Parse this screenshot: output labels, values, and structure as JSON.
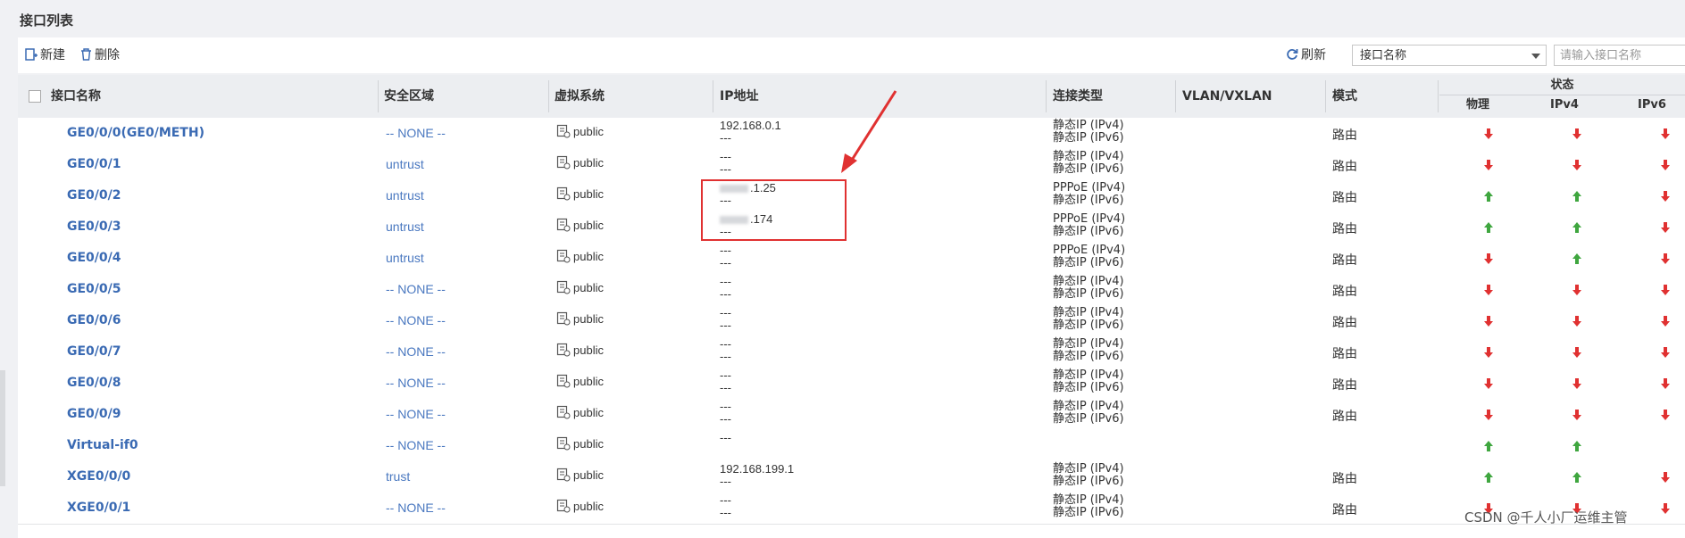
{
  "panel": {
    "title": "接口列表"
  },
  "toolbar": {
    "new_label": "新建",
    "delete_label": "删除",
    "refresh_label": "刷新",
    "filter_select_value": "接口名称",
    "search_placeholder": "请输入接口名称"
  },
  "columns": {
    "name": "接口名称",
    "zone": "安全区域",
    "vsys": "虚拟系统",
    "ip": "IP地址",
    "conn_type": "连接类型",
    "vlan": "VLAN/VXLAN",
    "mode": "模式",
    "status": "状态",
    "status_physical": "物理",
    "status_ipv4": "IPv4",
    "status_ipv6": "IPv6"
  },
  "colors": {
    "up": "#3fa63f",
    "down": "#e03131",
    "link": "#3a6ab3",
    "annotation": "#e03131"
  },
  "rows": [
    {
      "name": "GE0/0/0(GE0/METH)",
      "zone": "-- NONE --",
      "vsys": "public",
      "ip1": "192.168.0.1",
      "ip2": "---",
      "conn1": "静态IP (IPv4)",
      "conn2": "静态IP (IPv6)",
      "mode": "路由",
      "phy": "down",
      "v4": "down",
      "v6": "down"
    },
    {
      "name": "GE0/0/1",
      "zone": "untrust",
      "vsys": "public",
      "ip1": "---",
      "ip2": "---",
      "conn1": "静态IP (IPv4)",
      "conn2": "静态IP (IPv6)",
      "mode": "路由",
      "phy": "down",
      "v4": "down",
      "v6": "down"
    },
    {
      "name": "GE0/0/2",
      "zone": "untrust",
      "vsys": "public",
      "ip1": ".1.25",
      "ip2": "---",
      "conn1": "PPPoE (IPv4)",
      "conn2": "静态IP (IPv6)",
      "mode": "路由",
      "phy": "up",
      "v4": "up",
      "v6": "down"
    },
    {
      "name": "GE0/0/3",
      "zone": "untrust",
      "vsys": "public",
      "ip1": ".174",
      "ip2": "---",
      "conn1": "PPPoE (IPv4)",
      "conn2": "静态IP (IPv6)",
      "mode": "路由",
      "phy": "up",
      "v4": "up",
      "v6": "down"
    },
    {
      "name": "GE0/0/4",
      "zone": "untrust",
      "vsys": "public",
      "ip1": "---",
      "ip2": "---",
      "conn1": "PPPoE (IPv4)",
      "conn2": "静态IP (IPv6)",
      "mode": "路由",
      "phy": "down",
      "v4": "up",
      "v6": "down"
    },
    {
      "name": "GE0/0/5",
      "zone": "-- NONE --",
      "vsys": "public",
      "ip1": "---",
      "ip2": "---",
      "conn1": "静态IP (IPv4)",
      "conn2": "静态IP (IPv6)",
      "mode": "路由",
      "phy": "down",
      "v4": "down",
      "v6": "down"
    },
    {
      "name": "GE0/0/6",
      "zone": "-- NONE --",
      "vsys": "public",
      "ip1": "---",
      "ip2": "---",
      "conn1": "静态IP (IPv4)",
      "conn2": "静态IP (IPv6)",
      "mode": "路由",
      "phy": "down",
      "v4": "down",
      "v6": "down"
    },
    {
      "name": "GE0/0/7",
      "zone": "-- NONE --",
      "vsys": "public",
      "ip1": "---",
      "ip2": "---",
      "conn1": "静态IP (IPv4)",
      "conn2": "静态IP (IPv6)",
      "mode": "路由",
      "phy": "down",
      "v4": "down",
      "v6": "down"
    },
    {
      "name": "GE0/0/8",
      "zone": "-- NONE --",
      "vsys": "public",
      "ip1": "---",
      "ip2": "---",
      "conn1": "静态IP (IPv4)",
      "conn2": "静态IP (IPv6)",
      "mode": "路由",
      "phy": "down",
      "v4": "down",
      "v6": "down"
    },
    {
      "name": "GE0/0/9",
      "zone": "-- NONE --",
      "vsys": "public",
      "ip1": "---",
      "ip2": "---",
      "conn1": "静态IP (IPv4)",
      "conn2": "静态IP (IPv6)",
      "mode": "路由",
      "phy": "down",
      "v4": "down",
      "v6": "down"
    },
    {
      "name": "Virtual-if0",
      "zone": "-- NONE --",
      "vsys": "public",
      "ip1": "---",
      "ip2": "",
      "conn1": "",
      "conn2": "",
      "mode": "",
      "phy": "up",
      "v4": "up",
      "v6": ""
    },
    {
      "name": "XGE0/0/0",
      "zone": "trust",
      "vsys": "public",
      "ip1": "192.168.199.1",
      "ip2": "---",
      "conn1": "静态IP (IPv4)",
      "conn2": "静态IP (IPv6)",
      "mode": "路由",
      "phy": "up",
      "v4": "up",
      "v6": "down"
    },
    {
      "name": "XGE0/0/1",
      "zone": "-- NONE --",
      "vsys": "public",
      "ip1": "---",
      "ip2": "---",
      "conn1": "静态IP (IPv4)",
      "conn2": "静态IP (IPv6)",
      "mode": "路由",
      "phy": "down",
      "v4": "down",
      "v6": "down"
    }
  ],
  "watermark": "CSDN @千人小厂运维主管"
}
